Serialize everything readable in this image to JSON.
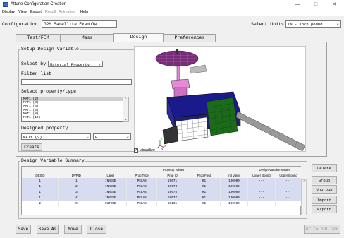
{
  "window": {
    "title": "Attune Configuration Creation",
    "minimize": "—",
    "maximize": "□",
    "close": "✕"
  },
  "menu": [
    "Display",
    "View",
    "Export",
    "Result",
    "Animation",
    "Help"
  ],
  "config": {
    "label": "Configuration",
    "value": "GPM Satellite Example"
  },
  "units": {
    "label": "Select Units",
    "value": "IN - inch pound"
  },
  "tabs": [
    "Test/FEM",
    "Mass",
    "Design",
    "Preferences"
  ],
  "setup": {
    "legend": "Setup Design Variable",
    "select_by_label": "Select by",
    "select_by_value": "Material Property",
    "filter_label": "Filter list",
    "filter_value": "",
    "prop_type_label": "Select property/type",
    "prop_list": [
      "MAT1 (2)",
      "MAT1 (3)",
      "MAT1 (4)",
      "MAT1 (6)",
      "MAT1 (8)",
      "MAT1 (10)"
    ],
    "designed_label": "Designed property",
    "designed_value": "MAT1 (2)",
    "designed_field": "E",
    "create_label": "Create"
  },
  "viewport": {
    "axis_z": "z",
    "axis_x": "x",
    "axis_y": "y",
    "visualize_label": "Visualize",
    "visualize_checked": "✓",
    "colors": {
      "antenna": "#7a2a7a",
      "body_blue": "#1a1a8c",
      "body_green": "#1b6b1b",
      "solar_panel": "#9a9a9a",
      "pink": "#e48ad6",
      "mesh": "#222222"
    }
  },
  "summary": {
    "legend": "Design Variable Summary",
    "group_headers": {
      "property_values": "Property Values",
      "design_variable_values": "Design Variable Values"
    },
    "columns": [
      "DESID",
      "DVPID",
      "Label",
      "Prop Type",
      "Prop ID",
      "Prop Field",
      "Init Value",
      "Lower Bound",
      "Upper Bound"
    ],
    "rows": [
      [
        "1",
        "1",
        "INNERE",
        "PELAS",
        "20071",
        "K1",
        "100000",
        "---",
        "---"
      ],
      [
        "1",
        "2",
        "INNERE",
        "PELAS",
        "20073",
        "K1",
        "100000",
        "---",
        "---"
      ],
      [
        "1",
        "3",
        "INNERE",
        "PELAS",
        "20075",
        "K1",
        "100000",
        "---",
        "---"
      ],
      [
        "1",
        "4",
        "INNERE",
        "PELAS",
        "20077",
        "K1",
        "100000",
        "---",
        "---"
      ],
      [
        "2",
        "5",
        "OUTERE",
        "PELAS",
        "20201",
        "K1",
        "100000",
        "---",
        "---"
      ]
    ],
    "side_buttons": [
      "Delete",
      "Group",
      "Ungroup",
      "Import",
      "Export"
    ]
  },
  "bottom_buttons": [
    "Save",
    "Save As",
    "Move",
    "Close"
  ],
  "write_button": "Write SOL 200"
}
